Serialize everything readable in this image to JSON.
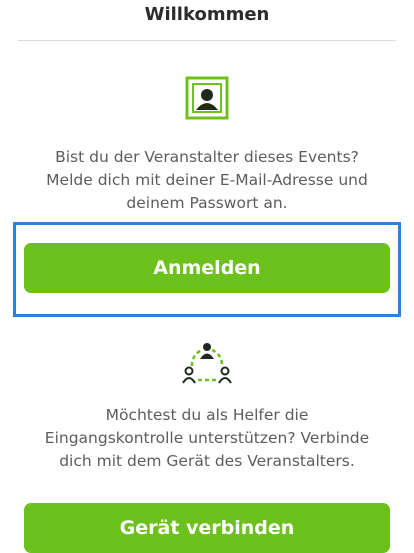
{
  "header": {
    "title": "Willkommen"
  },
  "organizer": {
    "icon": "portrait-photo-icon",
    "description": "Bist du der Veranstalter dieses Events? Melde dich mit deiner E-Mail-Adresse und deinem Passwort an.",
    "button_label": "Anmelden"
  },
  "helper": {
    "icon": "group-connect-icon",
    "description": "Möchtest du als Helfer die Eingangskontrolle unterstützen? Verbinde dich mit dem Gerät des Veranstalters.",
    "button_label": "Gerät verbinden"
  },
  "colors": {
    "accent_green": "#6cc11c",
    "highlight_blue": "#2d83d6"
  }
}
